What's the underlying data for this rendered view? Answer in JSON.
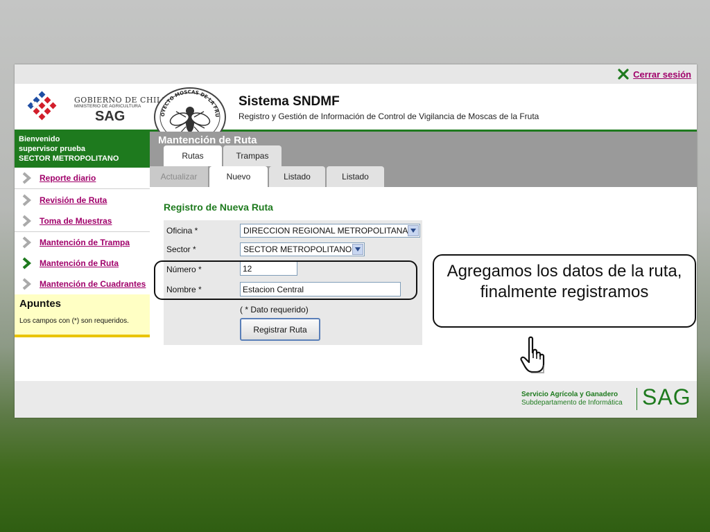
{
  "topbar": {
    "logout_label": "Cerrar sesión"
  },
  "header": {
    "gov_line1": "GOBIERNO DE CHILE",
    "gov_line2": "MINISTERIO DE AGRICULTURA",
    "gov_line3": "SAG",
    "seal_text": "PROYECTO MOSCAS DE LA FRUTA",
    "system_title": "Sistema SNDMF",
    "system_subtitle": "Registro y Gestión de Información de Control de Vigilancia de Moscas de la Fruta"
  },
  "sidebar": {
    "welcome_line1": "Bienvenido",
    "welcome_line2": "supervisor prueba",
    "welcome_line3": "SECTOR METROPOLITANO",
    "items": [
      {
        "label": "Reporte diario",
        "active": false
      },
      {
        "label": "Revisión de Ruta",
        "active": false
      },
      {
        "label": "Toma de Muestras",
        "active": false
      },
      {
        "label": "Mantención de Trampa",
        "active": false
      },
      {
        "label": "Mantención de Ruta",
        "active": true
      },
      {
        "label": "Mantención de Cuadrantes",
        "active": false
      }
    ],
    "notes_title": "Apuntes",
    "notes_text": "Los campos con (*) son requeridos."
  },
  "main": {
    "title": "Mantención de Ruta",
    "top_tabs": [
      "Rutas",
      "Trampas"
    ],
    "sub_tabs": [
      "Actualizar",
      "Nuevo",
      "Listado",
      "Listado"
    ],
    "form_title": "Registro de Nueva Ruta",
    "fields": {
      "oficina_label": "Oficina *",
      "oficina_value": "DIRECCION REGIONAL METROPOLITANA",
      "sector_label": "Sector *",
      "sector_value": "SECTOR METROPOLITANO",
      "numero_label": "Número *",
      "numero_value": "12",
      "nombre_label": "Nombre *",
      "nombre_value": "Estacion Central"
    },
    "required_note": "( * Dato requerido)",
    "submit_label": "Registrar Ruta"
  },
  "footer": {
    "org_name": "Servicio Agrícola y Ganadero",
    "org_dept": "Subdepartamento de Informática",
    "org_logo": "SAG"
  },
  "callout": {
    "line1": "Agregamos los datos de la ruta,",
    "line2": "finalmente registramos"
  },
  "colors": {
    "brand_green": "#1e7a1e",
    "link_magenta": "#a0006a",
    "header_gray": "#9a9a9a",
    "notes_yellow": "#ffffc4"
  }
}
